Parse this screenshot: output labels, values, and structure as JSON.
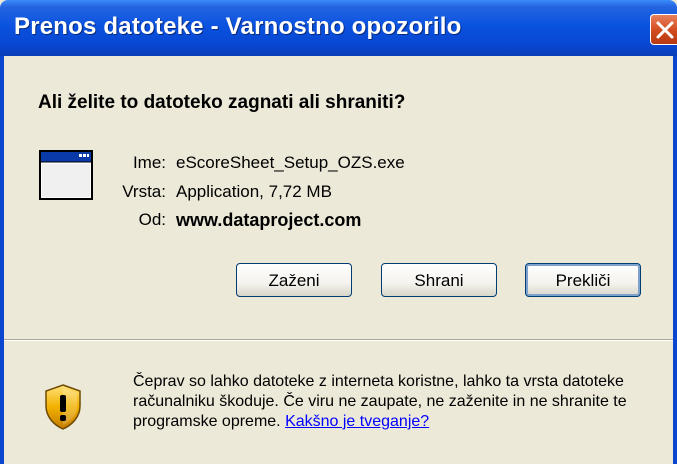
{
  "window": {
    "title": "Prenos datoteke - Varnostno opozorilo"
  },
  "dialog": {
    "question": "Ali želite to datoteko zagnati ali shraniti?",
    "file": {
      "name_label": "Ime:",
      "name_value": "eScoreSheet_Setup_OZS.exe",
      "type_label": "Vrsta:",
      "type_value": "Application, 7,72 MB",
      "from_label": "Od:",
      "from_value": "www.dataproject.com"
    },
    "buttons": {
      "run": "Zaženi",
      "save": "Shrani",
      "cancel": "Prekliči"
    },
    "warning": {
      "text": "Čeprav so lahko datoteke z interneta koristne, lahko ta vrsta datoteke računalniku škoduje. Če viru ne zaupate, ne zaženite in ne shranite te programske opreme. ",
      "link": "Kakšno je tveganje?"
    }
  },
  "colors": {
    "titlebar": "#0A52E0",
    "close_button": "#D24A1E",
    "dialog_bg": "#ECE9D8",
    "link": "#0000FF"
  },
  "icons": [
    "close-icon",
    "application-window-icon",
    "security-shield-warning-icon"
  ]
}
